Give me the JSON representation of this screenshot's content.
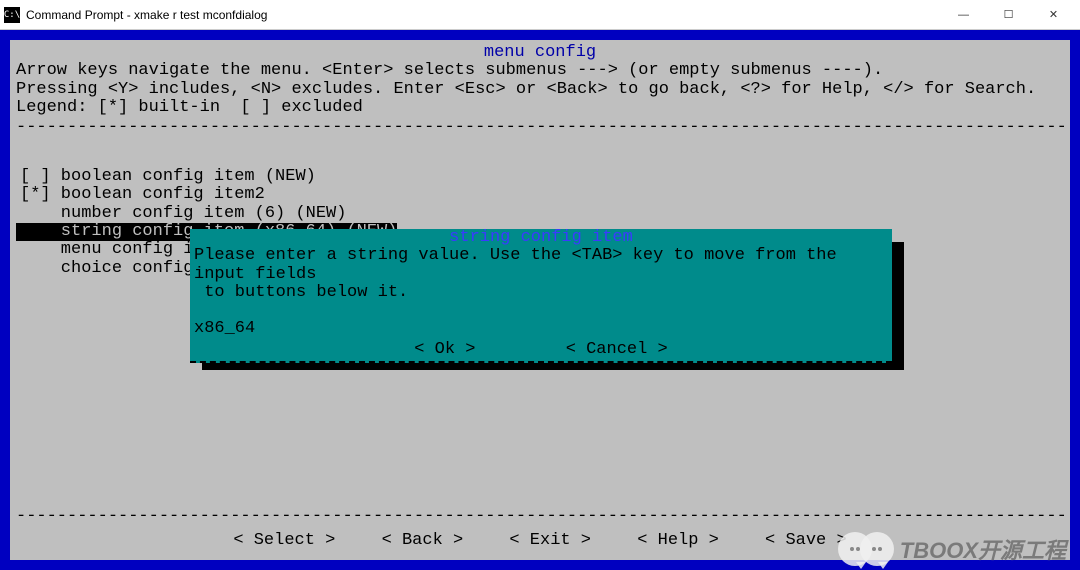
{
  "window": {
    "icon_text": "C:\\",
    "title": "Command Prompt - xmake  r test mconfdialog",
    "min": "—",
    "max": "☐",
    "close": "✕"
  },
  "panel": {
    "title": "menu config",
    "help": "Arrow keys navigate the menu. <Enter> selects submenus ---> (or empty submenus ----).\nPressing <Y> includes, <N> excludes. Enter <Esc> or <Back> to go back, <?> for Help, </> for Search. Legend: [*] built-in  [ ] excluded"
  },
  "menu": {
    "items": [
      {
        "text": "[ ] boolean config item (NEW)",
        "selected": false
      },
      {
        "text": "[*] boolean config item2",
        "selected": false
      },
      {
        "text": "    number config item (6) (NEW)",
        "selected": false
      },
      {
        "text": "    string config item (x86_64) (NEW)",
        "selected": true
      },
      {
        "text": "    menu config i",
        "selected": false
      },
      {
        "text": "    choice config",
        "selected": false
      }
    ]
  },
  "buttons": {
    "select": "< Select >",
    "back": "< Back >",
    "exit": "< Exit >",
    "help": "< Help >",
    "save": "< Save >"
  },
  "dialog": {
    "title": "string config item",
    "body": "Please enter a string value. Use the <TAB> key to move from the input fields\n to buttons below it.",
    "value": "x86_64",
    "ok": "<  Ok  >",
    "cancel": "< Cancel >"
  },
  "watermark": {
    "text": "TBOOX开源工程"
  }
}
